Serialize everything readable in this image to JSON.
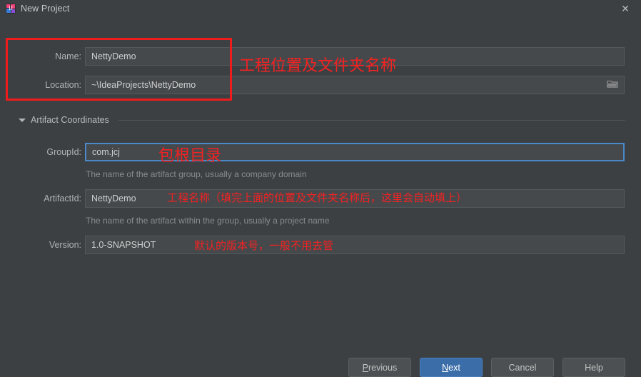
{
  "window": {
    "title": "New Project",
    "app_icon": "intellij-idea-icon",
    "close_icon": "close-icon",
    "background_color": "#3c4043",
    "accent_color": "#3b6ea8",
    "annotation_color": "#ee1c1c"
  },
  "top_fields": [
    {
      "label": "Name:",
      "value": "NettyDemo",
      "name": "project-name"
    },
    {
      "label": "Location:",
      "value": "~\\IdeaProjects\\NettyDemo",
      "name": "project-location",
      "browse_icon": "folder-icon"
    }
  ],
  "section": {
    "title": "Artifact Coordinates",
    "expanded": true,
    "toggle_icon": "chevron-down-icon"
  },
  "artifact_fields": [
    {
      "label": "GroupId:",
      "value": "com.jcj",
      "hint": "The name of the artifact group, usually a company domain",
      "focused": true,
      "name": "group-id"
    },
    {
      "label": "ArtifactId:",
      "value": "NettyDemo",
      "hint": "The name of the artifact within the group, usually a project name",
      "focused": false,
      "name": "artifact-id"
    },
    {
      "label": "Version:",
      "value": "1.0-SNAPSHOT",
      "hint": "",
      "focused": false,
      "name": "version"
    }
  ],
  "annotations": [
    {
      "text": "工程位置及文件夹名称",
      "name": "annotation-location-name"
    },
    {
      "text": "包根目录",
      "name": "annotation-group-id"
    },
    {
      "text": "工程名称（填完上面的位置及文件夹名称后，这里会自动填上）",
      "name": "annotation-artifact-id"
    },
    {
      "text": "默认的版本号，一般不用去管",
      "name": "annotation-version"
    }
  ],
  "buttons": [
    {
      "label": "Previous",
      "mnemonic": "P",
      "primary": false,
      "name": "previous-button"
    },
    {
      "label": "Next",
      "mnemonic": "N",
      "primary": true,
      "name": "next-button"
    },
    {
      "label": "Cancel",
      "mnemonic": "",
      "primary": false,
      "name": "cancel-button"
    },
    {
      "label": "Help",
      "mnemonic": "",
      "primary": false,
      "name": "help-button"
    }
  ]
}
